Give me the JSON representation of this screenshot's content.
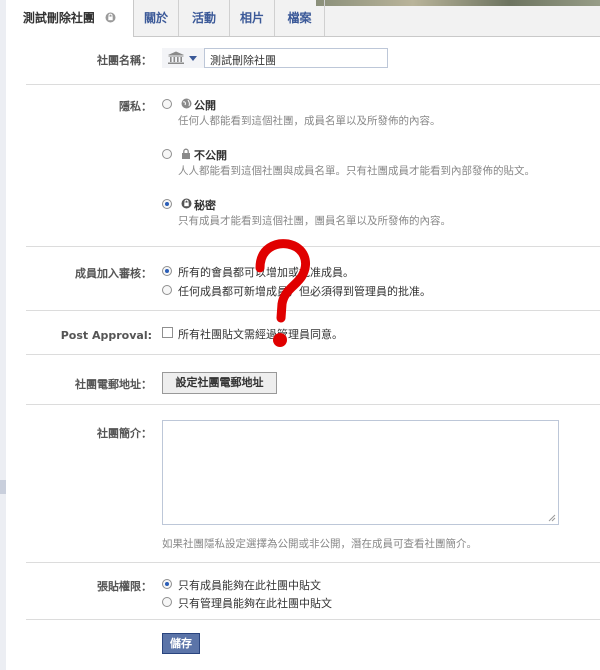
{
  "tabs": [
    {
      "label": "測試刪除社團",
      "active": true
    },
    {
      "label": "關於"
    },
    {
      "label": "活動"
    },
    {
      "label": "相片"
    },
    {
      "label": "檔案"
    }
  ],
  "group_name": {
    "label": "社團名稱：",
    "value": "測試刪除社團",
    "icon": "bank-icon"
  },
  "privacy": {
    "label": "隱私：",
    "options": [
      {
        "title": "公開",
        "desc": "任何人都能看到這個社團，成員名單以及所發佈的內容。",
        "icon": "globe-icon",
        "selected": false
      },
      {
        "title": "不公開",
        "desc": "人人都能看到這個社團與成員名單。只有社團成員才能看到內部發佈的貼文。",
        "icon": "lock-icon",
        "selected": false
      },
      {
        "title": "秘密",
        "desc": "只有成員才能看到這個社團，團員名單以及所發佈的內容。",
        "icon": "secret-icon",
        "selected": true
      }
    ]
  },
  "membership": {
    "label": "成員加入審核：",
    "options": [
      {
        "text": "所有的會員都可以增加或批准成員。",
        "selected": true
      },
      {
        "text": "任何成員都可新增成員，但必須得到管理員的批准。",
        "selected": false
      }
    ]
  },
  "post_approval": {
    "label": "Post Approval:",
    "text": "所有社團貼文需經過管理員同意。",
    "checked": false
  },
  "email": {
    "label": "社團電郵地址：",
    "button": "設定社團電郵地址"
  },
  "description": {
    "label": "社團簡介：",
    "value": "",
    "note": "如果社團隱私設定選擇為公開或非公開，潛在成員可查看社團簡介。"
  },
  "posting": {
    "label": "張貼權限：",
    "options": [
      {
        "text": "只有成員能夠在此社團中貼文",
        "selected": true
      },
      {
        "text": "只有管理員能夠在此社團中貼文",
        "selected": false
      }
    ]
  },
  "save_label": "儲存",
  "colors": {
    "link": "#3b5998",
    "button": "#5b74a8",
    "overlay_question": "#e00000"
  }
}
